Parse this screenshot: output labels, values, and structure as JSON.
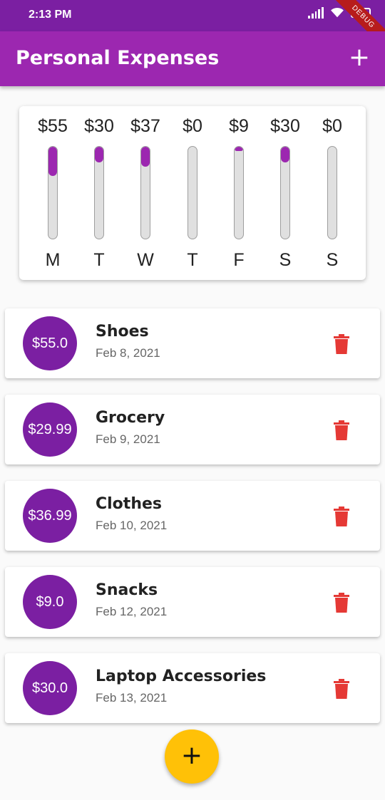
{
  "status": {
    "time": "2:13 PM",
    "battery": "33",
    "debug_label": "DEBUG"
  },
  "app_bar": {
    "title": "Personal Expenses",
    "add_label": "+"
  },
  "chart": [
    {
      "amount": "$55",
      "day": "M",
      "fraction": 0.32
    },
    {
      "amount": "$30",
      "day": "T",
      "fraction": 0.17
    },
    {
      "amount": "$37",
      "day": "W",
      "fraction": 0.22
    },
    {
      "amount": "$0",
      "day": "T",
      "fraction": 0
    },
    {
      "amount": "$9",
      "day": "F",
      "fraction": 0.05
    },
    {
      "amount": "$30",
      "day": "S",
      "fraction": 0.17
    },
    {
      "amount": "$0",
      "day": "S",
      "fraction": 0
    }
  ],
  "transactions": [
    {
      "amount": "$55.0",
      "title": "Shoes",
      "date": "Feb 8, 2021"
    },
    {
      "amount": "$29.99",
      "title": "Grocery",
      "date": "Feb 9, 2021"
    },
    {
      "amount": "$36.99",
      "title": "Clothes",
      "date": "Feb 10, 2021"
    },
    {
      "amount": "$9.0",
      "title": "Snacks",
      "date": "Feb 12, 2021"
    },
    {
      "amount": "$30.0",
      "title": "Laptop Accessories",
      "date": "Feb 13, 2021"
    }
  ],
  "fab": {
    "label": "+"
  },
  "colors": {
    "primary": "#9c27b0",
    "primary_dark": "#7b1fa2",
    "accent": "#ffc107",
    "delete": "#e53935"
  }
}
